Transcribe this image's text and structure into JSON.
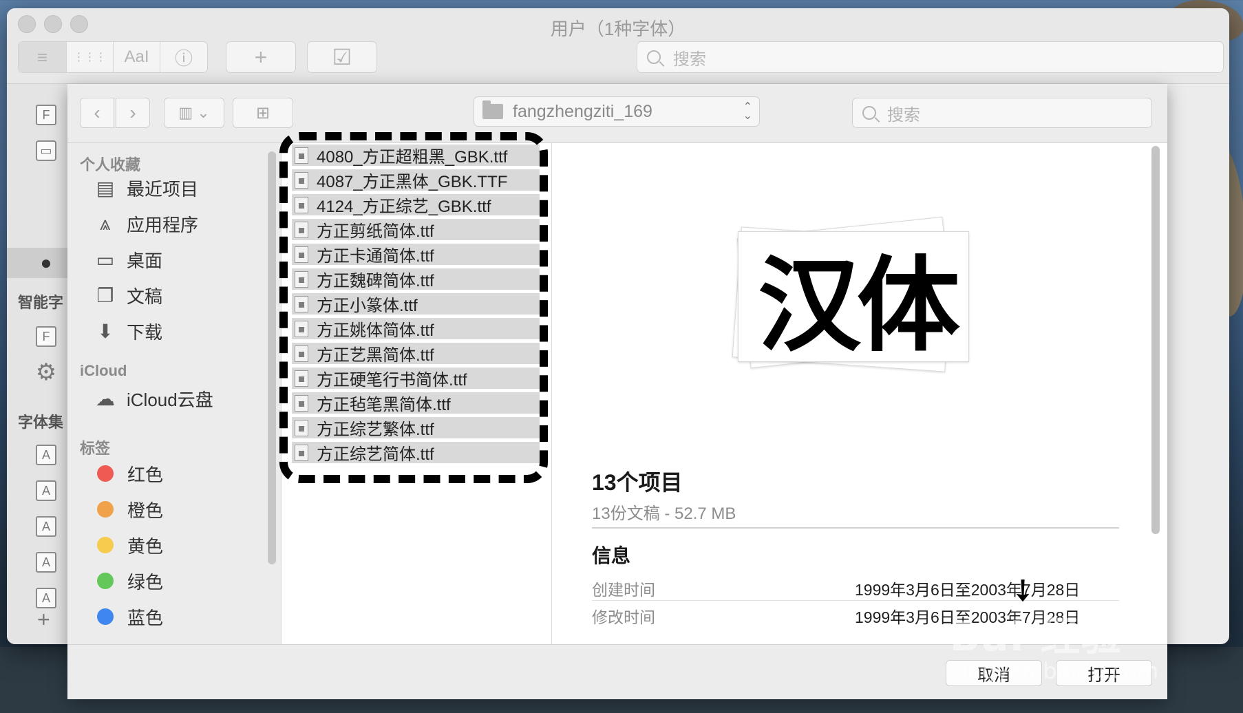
{
  "window": {
    "title": "用户（1种字体）"
  },
  "toolbar": {
    "view_buttons": [
      "≡",
      "⋮⋮⋮",
      "AaI",
      "ⓘ"
    ],
    "add_button": "+",
    "validate_button": "☑",
    "search_placeholder": "搜索"
  },
  "fontbook_sidebar": {
    "smart_label": "智能字",
    "collections_label": "字体集"
  },
  "sheet": {
    "folder_name": "fangzhengziti_169",
    "search_placeholder": "搜索",
    "sidebar": {
      "favorites_header": "个人收藏",
      "favorites": [
        {
          "label": "最近项目"
        },
        {
          "label": "应用程序"
        },
        {
          "label": "桌面"
        },
        {
          "label": "文稿"
        },
        {
          "label": "下载"
        }
      ],
      "icloud_header": "iCloud",
      "icloud_items": [
        {
          "label": "iCloud云盘"
        }
      ],
      "tags_header": "标签",
      "tags": [
        {
          "label": "红色",
          "color": "#ef5b52"
        },
        {
          "label": "橙色",
          "color": "#f0a24b"
        },
        {
          "label": "黄色",
          "color": "#f5cc4d"
        },
        {
          "label": "绿色",
          "color": "#64c75a"
        },
        {
          "label": "蓝色",
          "color": "#3f86f0"
        }
      ]
    },
    "files": [
      "4080_方正超粗黑_GBK.ttf",
      "4087_方正黑体_GBK.TTF",
      "4124_方正综艺_GBK.ttf",
      "方正剪纸简体.ttf",
      "方正卡通简体.ttf",
      "方正魏碑简体.ttf",
      "方正小篆体.ttf",
      "方正姚体简体.ttf",
      "方正艺黑简体.ttf",
      "方正硬笔行书简体.ttf",
      "方正毡笔黑简体.ttf",
      "方正综艺繁体.ttf",
      "方正综艺简体.ttf"
    ],
    "preview": {
      "glyph": "汉体",
      "title": "13个项目",
      "subtitle": "13份文稿 - 52.7 MB",
      "info_header": "信息",
      "meta": [
        {
          "key": "创建时间",
          "value": "1999年3月6日至2003年7月28日"
        },
        {
          "key": "修改时间",
          "value": "1999年3月6日至2003年7月28日"
        }
      ]
    },
    "footer": {
      "cancel": "取消",
      "open": "打开"
    }
  },
  "watermark": {
    "brand": "Bai 经验",
    "url": "jingyan.baidu.com"
  }
}
